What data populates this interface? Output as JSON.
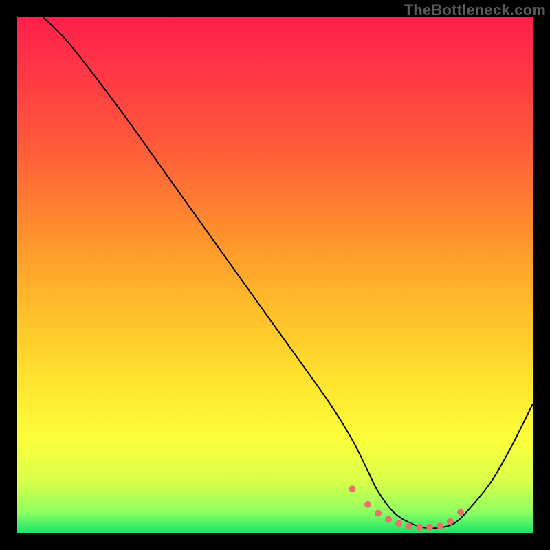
{
  "watermark": "TheBottleneck.com",
  "gradient": {
    "stops": [
      {
        "offset": "0%",
        "color": "#ff1f4b"
      },
      {
        "offset": "12%",
        "color": "#ff3a44"
      },
      {
        "offset": "25%",
        "color": "#ff5a3a"
      },
      {
        "offset": "40%",
        "color": "#ff8a2e"
      },
      {
        "offset": "55%",
        "color": "#ffb92a"
      },
      {
        "offset": "70%",
        "color": "#ffe22e"
      },
      {
        "offset": "82%",
        "color": "#fbff3a"
      },
      {
        "offset": "90%",
        "color": "#d9ff4a"
      },
      {
        "offset": "96%",
        "color": "#8fff60"
      },
      {
        "offset": "100%",
        "color": "#19e56a"
      }
    ]
  },
  "chart_data": {
    "type": "line",
    "title": "",
    "xlabel": "",
    "ylabel": "",
    "xlim": [
      0,
      100
    ],
    "ylim": [
      0,
      100
    ],
    "legend": false,
    "grid": false,
    "annotations": [],
    "series": [
      {
        "name": "bottleneck-curve",
        "color": "#000000",
        "x": [
          5,
          10,
          20,
          30,
          40,
          50,
          60,
          65,
          68,
          70,
          73,
          76,
          79,
          82,
          85,
          88,
          92,
          96,
          100
        ],
        "y": [
          100,
          95,
          82,
          68,
          54,
          40,
          26,
          18,
          12,
          8,
          4,
          2,
          1,
          1,
          2,
          5,
          10,
          17,
          25
        ]
      }
    ],
    "markers": {
      "name": "optimal-range-dots",
      "color": "#e6726a",
      "radius": 5,
      "x": [
        65,
        68,
        70,
        72,
        74,
        76,
        78,
        80,
        82,
        84,
        86
      ],
      "y": [
        8.5,
        5.5,
        3.8,
        2.6,
        1.8,
        1.3,
        1.1,
        1.1,
        1.3,
        2.2,
        4.0
      ]
    }
  }
}
